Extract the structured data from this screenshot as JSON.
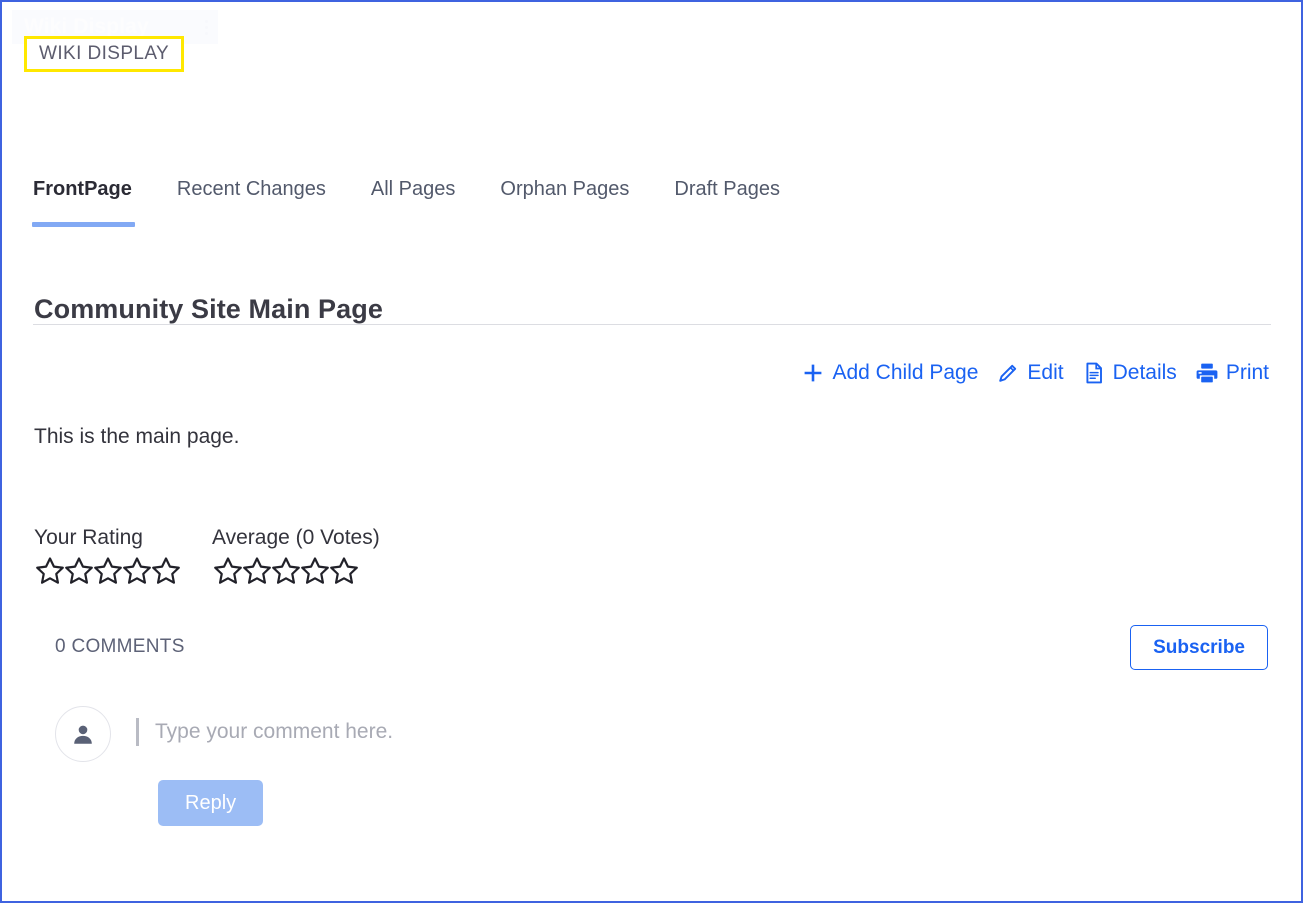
{
  "window": {
    "border_color": "#3f63e0"
  },
  "portlet_header": {
    "title": "Wiki Display",
    "menu_icon": "kebab-menu-icon"
  },
  "highlight": {
    "label": "WIKI DISPLAY",
    "border_color": "#ffe800"
  },
  "tabs": [
    {
      "label": "FrontPage",
      "active": true
    },
    {
      "label": "Recent Changes",
      "active": false
    },
    {
      "label": "All Pages",
      "active": false
    },
    {
      "label": "Orphan Pages",
      "active": false
    },
    {
      "label": "Draft Pages",
      "active": false
    }
  ],
  "page": {
    "title": "Community Site Main Page",
    "content": "This is the main page."
  },
  "actions": [
    {
      "label": "Add Child Page",
      "icon": "plus-icon"
    },
    {
      "label": "Edit",
      "icon": "pencil-icon"
    },
    {
      "label": "Details",
      "icon": "document-icon"
    },
    {
      "label": "Print",
      "icon": "printer-icon"
    }
  ],
  "ratings": {
    "your_rating": {
      "label": "Your Rating",
      "stars_total": 5,
      "stars_filled": 0
    },
    "average": {
      "label": "Average (0 Votes)",
      "stars_total": 5,
      "stars_filled": 0
    }
  },
  "comments": {
    "count_label": "0 COMMENTS",
    "subscribe_label": "Subscribe",
    "avatar_icon": "user-avatar-icon",
    "input_placeholder": "Type your comment here.",
    "input_value": "",
    "reply_label": "Reply"
  },
  "colors": {
    "link_blue": "#1a62f2",
    "tab_underline": "#82a9f4",
    "reply_button": "#9cbdf5",
    "highlight_yellow": "#ffe800"
  }
}
